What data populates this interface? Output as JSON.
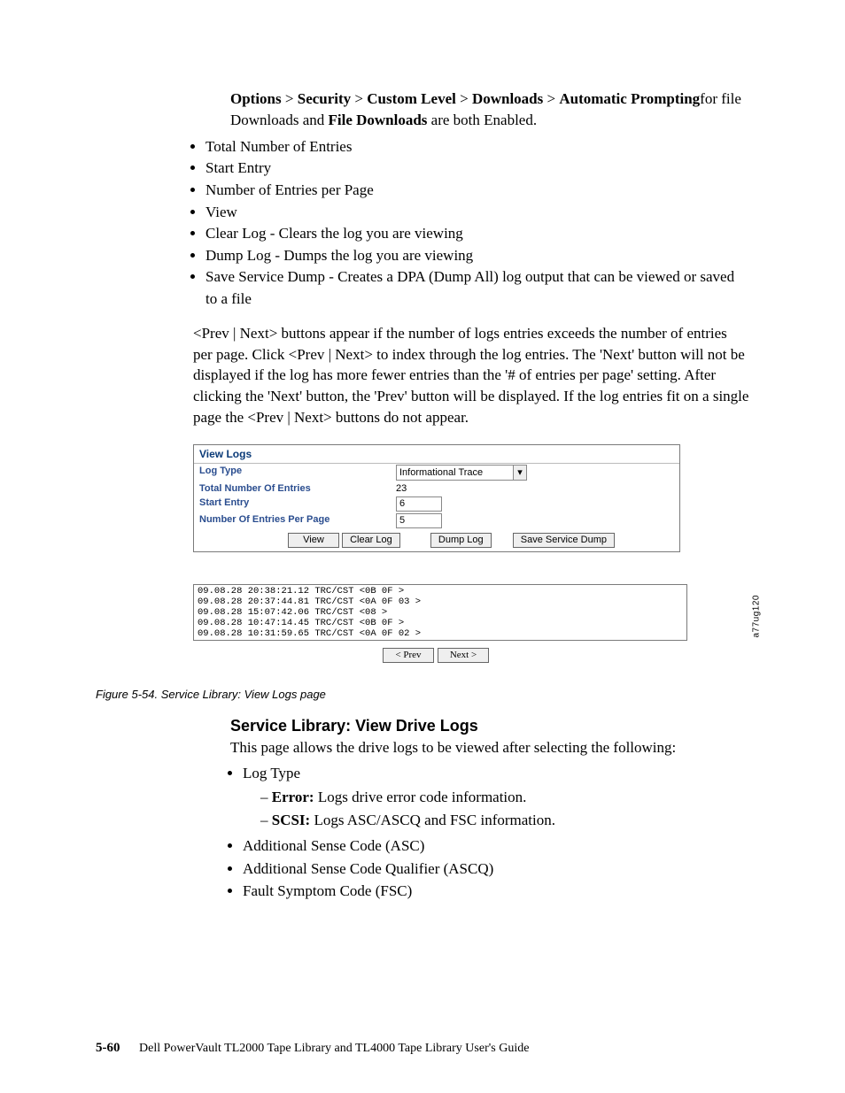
{
  "breadcrumb": {
    "p1": "Options",
    "p2": "Security",
    "p3": "Custom Level",
    "p4": "Downloads",
    "p5": "Automatic Prompting",
    "mid": "for file Downloads and ",
    "p6": "File Downloads",
    "tail": " are both Enabled."
  },
  "main_bullets": [
    "Total Number of Entries",
    "Start Entry",
    "Number of Entries per Page",
    "View",
    "Clear Log - Clears the log you are viewing",
    "Dump Log - Dumps the log you are viewing",
    "Save Service Dump - Creates a DPA (Dump All) log output that can be viewed or saved to a file"
  ],
  "body_para": "<Prev | Next> buttons appear if the number of logs entries exceeds the number of entries per page. Click <Prev | Next> to index through the log entries. The 'Next' button will not be displayed if the log has more fewer entries than the '# of entries per page' setting. After clicking the 'Next' button, the 'Prev' button will be displayed. If the log entries fit on a single page the <Prev | Next> buttons do not appear.",
  "panel": {
    "title": "View Logs",
    "rows": {
      "log_type_label": "Log Type",
      "log_type_value": "Informational Trace",
      "total_label": "Total Number Of Entries",
      "total_value": "23",
      "start_label": "Start Entry",
      "start_value": "6",
      "perpage_label": "Number Of Entries Per Page",
      "perpage_value": "5"
    },
    "buttons": {
      "view": "View",
      "clear": "Clear Log",
      "dump": "Dump Log",
      "save": "Save Service Dump"
    },
    "log_lines": [
      "09.08.28 20:38:21.12 TRC/CST <0B 0F >",
      "09.08.28 20:37:44.81 TRC/CST <0A 0F 03 >",
      "09.08.28 15:07:42.06 TRC/CST <08 >",
      "09.08.28 10:47:14.45 TRC/CST <0B 0F >",
      "09.08.28 10:31:59.65 TRC/CST <0A 0F 02 >"
    ],
    "pager": {
      "prev": "< Prev",
      "next": "Next >"
    },
    "side_label": "a77ug120"
  },
  "figure_caption": "Figure 5-54. Service Library: View Logs page",
  "section2": {
    "heading": "Service Library: View Drive Logs",
    "intro": "This page allows the drive logs to be viewed after selecting the following:",
    "items": {
      "log_type": "Log Type",
      "error_b": "Error:",
      "error_t": " Logs drive error code information.",
      "scsi_b": "SCSI:",
      "scsi_t": " Logs ASC/ASCQ and FSC information.",
      "asc": "Additional Sense Code (ASC)",
      "ascq": "Additional Sense Code Qualifier (ASCQ)",
      "fsc": "Fault Symptom Code (FSC)"
    }
  },
  "footer": {
    "page": "5-60",
    "title": "Dell PowerVault TL2000 Tape Library and TL4000 Tape Library User's Guide"
  }
}
